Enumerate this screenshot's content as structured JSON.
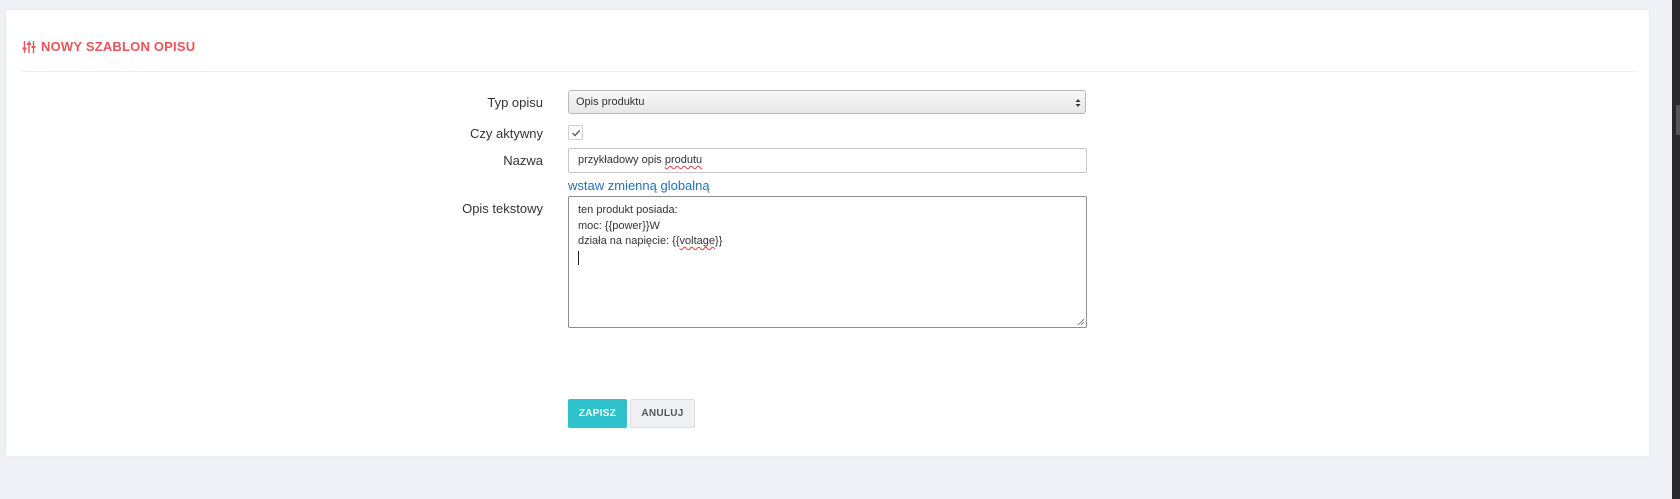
{
  "header": {
    "icon": "sliders-icon",
    "title": "NOWY SZABLON OPISU"
  },
  "form": {
    "type_label": "Typ opisu",
    "type_value": "Opis produktu",
    "active_label": "Czy aktywny",
    "active_checked": true,
    "name_label": "Nazwa",
    "name_value_prefix": "przykładowy opis ",
    "name_value_misspelled": "produtu",
    "insert_variable_link": "wstaw zmienną globalną",
    "text_label": "Opis tekstowy",
    "text_lines": [
      "ten produkt posiada:",
      "moc: {{power}}W",
      "działa na napięcie: {{voltage}}"
    ],
    "text_line3_prefix": "działa na napięcie: {{",
    "text_line3_misspelled": "voltage",
    "text_line3_suffix": "}}"
  },
  "actions": {
    "save_label": "ZAPISZ",
    "cancel_label": "ANULUJ"
  },
  "colors": {
    "accent_red": "#e9545a",
    "save_teal": "#2fc2cd",
    "link_blue": "#2a6fb3"
  }
}
